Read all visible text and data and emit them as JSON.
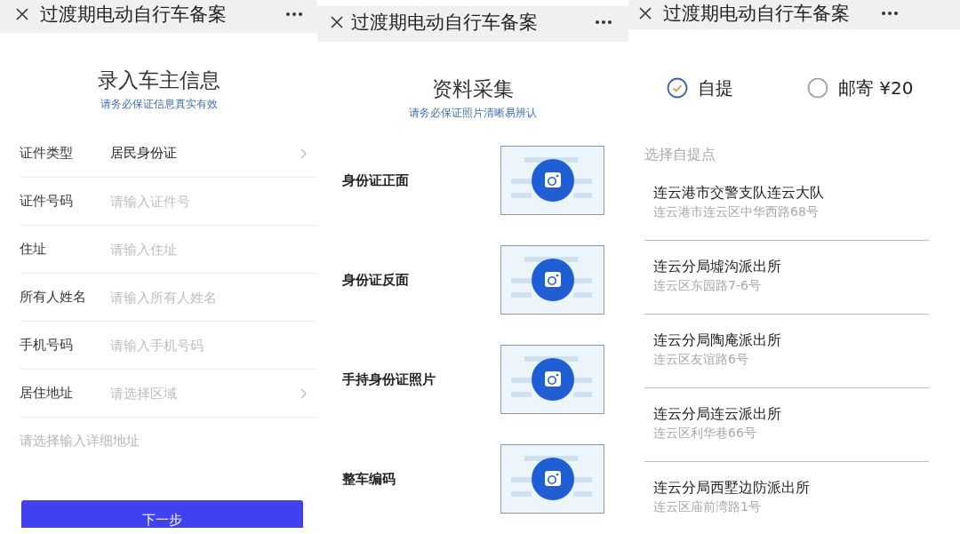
{
  "screens": [
    {
      "kind": "owner_form",
      "title": "过渡期电动自行车备案",
      "heading": "录入车主信息",
      "subtitle": "请务必保证信息真实有效",
      "fields": [
        {
          "kind": "select",
          "label": "证件类型",
          "value": "居民身份证"
        },
        {
          "kind": "input",
          "label": "证件号码",
          "placeholder": "请输入证件号"
        },
        {
          "kind": "input",
          "label": "住址",
          "placeholder": "请输入住址"
        },
        {
          "kind": "input",
          "label": "所有人姓名",
          "placeholder": "请输入所有人姓名"
        },
        {
          "kind": "input",
          "label": "手机号码",
          "placeholder": "请输入手机号码"
        },
        {
          "kind": "select",
          "label": "居住地址",
          "placeholder": "请选择区域"
        }
      ],
      "detail_address": {
        "placeholder": "请选择输入详细地址"
      },
      "next_button": {
        "label": "下一步"
      }
    },
    {
      "kind": "photo_upload",
      "title": "过渡期电动自行车备案",
      "heading": "资料采集",
      "subtitle": "请务必保证照片清晰易辨认",
      "uploads": [
        {
          "label": "身份证正面"
        },
        {
          "label": "身份证反面"
        },
        {
          "label": "手持身份证照片"
        },
        {
          "label": "整车编码"
        }
      ]
    },
    {
      "kind": "pickup_choice",
      "title": "过渡期电动自行车备案",
      "delivery_options": [
        {
          "label": "自提",
          "selected": true
        },
        {
          "label": "邮寄 ¥20",
          "selected": false
        }
      ],
      "section_label": "选择自提点",
      "pickup_points": [
        {
          "name": "连云港市交警支队连云大队",
          "address": "连云港市连云区中华西路68号"
        },
        {
          "name": "连云分局墟沟派出所",
          "address": "连云区东园路7-6号"
        },
        {
          "name": "连云分局陶庵派出所",
          "address": "连云区友谊路6号"
        },
        {
          "name": "连云分局连云派出所",
          "address": "连云区利华巷66号"
        },
        {
          "name": "连云分局西墅边防派出所",
          "address": "连云区庙前湾路1号"
        }
      ]
    }
  ]
}
